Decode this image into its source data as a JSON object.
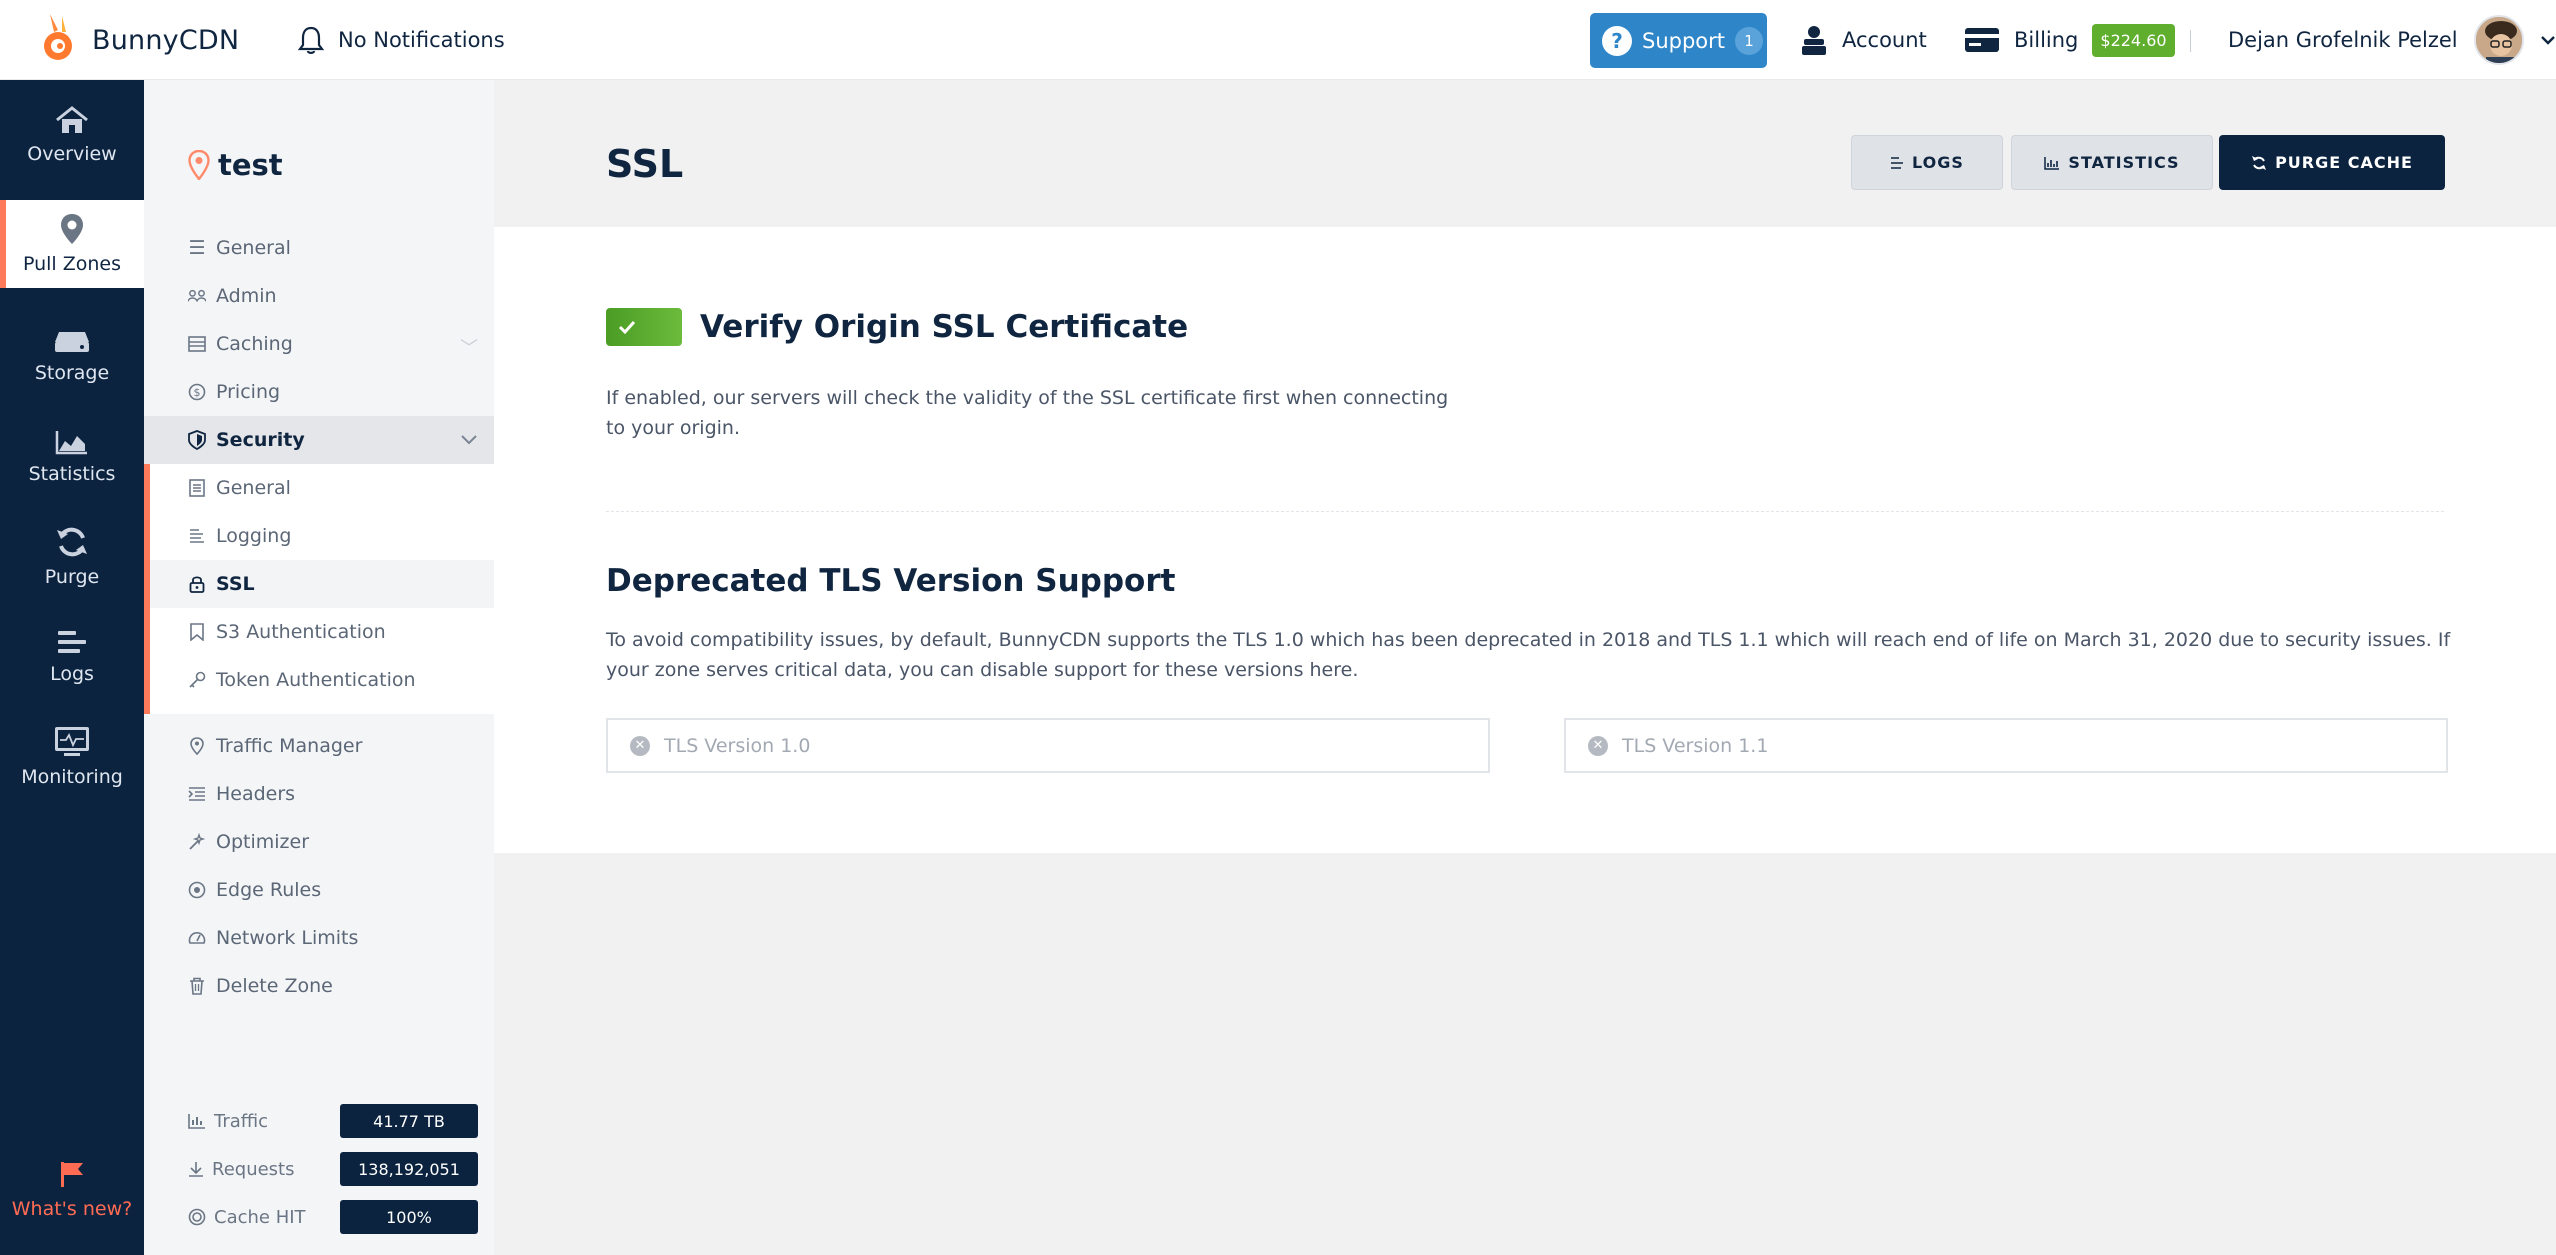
{
  "topbar": {
    "brand": "BunnyCDN",
    "notifications": "No Notifications",
    "support_label": "Support",
    "support_count": "1",
    "account_label": "Account",
    "billing_label": "Billing",
    "billing_amount": "$224.60",
    "user_name": "Dejan Grofelnik Pelzel"
  },
  "leftnav": {
    "items": [
      {
        "label": "Overview",
        "icon": "home-icon"
      },
      {
        "label": "Pull Zones",
        "icon": "location-pin-icon"
      },
      {
        "label": "Storage",
        "icon": "storage-drive-icon"
      },
      {
        "label": "Statistics",
        "icon": "area-chart-icon"
      },
      {
        "label": "Purge",
        "icon": "refresh-icon"
      },
      {
        "label": "Logs",
        "icon": "log-lines-icon"
      },
      {
        "label": "Monitoring",
        "icon": "monitor-icon"
      }
    ],
    "whats_new": "What's new?"
  },
  "sidebar": {
    "zone_name": "test",
    "items": [
      {
        "label": "General",
        "icon": "list-icon"
      },
      {
        "label": "Admin",
        "icon": "users-icon"
      },
      {
        "label": "Caching",
        "icon": "cache-icon"
      },
      {
        "label": "Pricing",
        "icon": "dollar-icon"
      },
      {
        "label": "Security",
        "icon": "shield-icon"
      },
      {
        "label": "General",
        "icon": "document-icon"
      },
      {
        "label": "Logging",
        "icon": "log-icon"
      },
      {
        "label": "SSL",
        "icon": "lock-icon"
      },
      {
        "label": "S3 Authentication",
        "icon": "bookmark-icon"
      },
      {
        "label": "Token Authentication",
        "icon": "key-icon"
      },
      {
        "label": "Traffic Manager",
        "icon": "pin-icon"
      },
      {
        "label": "Headers",
        "icon": "headers-icon"
      },
      {
        "label": "Optimizer",
        "icon": "wand-icon"
      },
      {
        "label": "Edge Rules",
        "icon": "target-icon"
      },
      {
        "label": "Network Limits",
        "icon": "gauge-icon"
      },
      {
        "label": "Delete Zone",
        "icon": "trash-icon"
      }
    ],
    "stats": [
      {
        "label": "Traffic",
        "value": "41.77 TB",
        "icon": "bar-chart-icon"
      },
      {
        "label": "Requests",
        "value": "138,192,051",
        "icon": "download-icon"
      },
      {
        "label": "Cache HIT",
        "value": "100%",
        "icon": "target-icon"
      }
    ]
  },
  "main": {
    "title": "SSL",
    "buttons": {
      "logs": "LOGS",
      "statistics": "STATISTICS",
      "purge": "PURGE CACHE"
    },
    "verify_title": "Verify Origin SSL Certificate",
    "verify_desc": "If enabled, our servers will check the validity of the SSL certificate first when connecting to your origin.",
    "tls_title": "Deprecated TLS Version Support",
    "tls_desc": "To avoid compatibility issues, by default, BunnyCDN supports the TLS 1.0 which has been deprecated in 2018 and TLS 1.1 which will reach end of life on March 31, 2020 due to security issues. If your zone serves critical data, you can disable support for these versions here.",
    "tls_v10": "TLS Version 1.0",
    "tls_v11": "TLS Version 1.1"
  },
  "colors": {
    "navy": "#0c2340",
    "accent": "#ff7a5a",
    "support": "#2e86c9",
    "success": "#5fae2e"
  }
}
